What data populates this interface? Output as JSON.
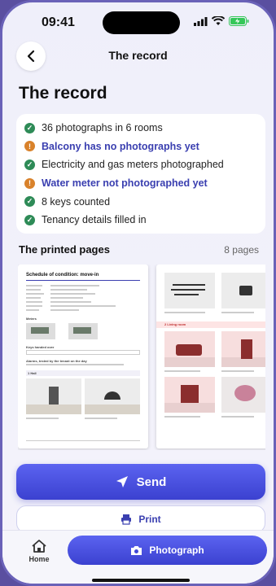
{
  "status": {
    "time": "09:41"
  },
  "nav": {
    "title": "The record"
  },
  "page": {
    "heading": "The record"
  },
  "checklist": [
    {
      "kind": "ok",
      "text": "36 photographs in 6 rooms"
    },
    {
      "kind": "warn",
      "text": "Balcony has no photographs yet"
    },
    {
      "kind": "ok",
      "text": "Electricity and gas meters photographed"
    },
    {
      "kind": "warn",
      "text": "Water meter not photographed yet"
    },
    {
      "kind": "ok",
      "text": "8 keys counted"
    },
    {
      "kind": "ok",
      "text": "Tenancy details filled in"
    }
  ],
  "printed": {
    "heading": "The printed pages",
    "count": "8 pages"
  },
  "preview": {
    "page1": {
      "title": "Schedule of condition: move-in",
      "meters": "Meters",
      "keys": "Keys handed over",
      "alarms": "Alarms, tested by the tenant on the day",
      "room": "1 Hall"
    },
    "page2": {
      "room": "2 Living room"
    }
  },
  "actions": {
    "send": "Send",
    "print": "Print"
  },
  "tabbar": {
    "home": "Home",
    "photograph": "Photograph"
  },
  "colors": {
    "accent": "#4148d8",
    "ok": "#2e8b57",
    "warn": "#d9822b"
  }
}
